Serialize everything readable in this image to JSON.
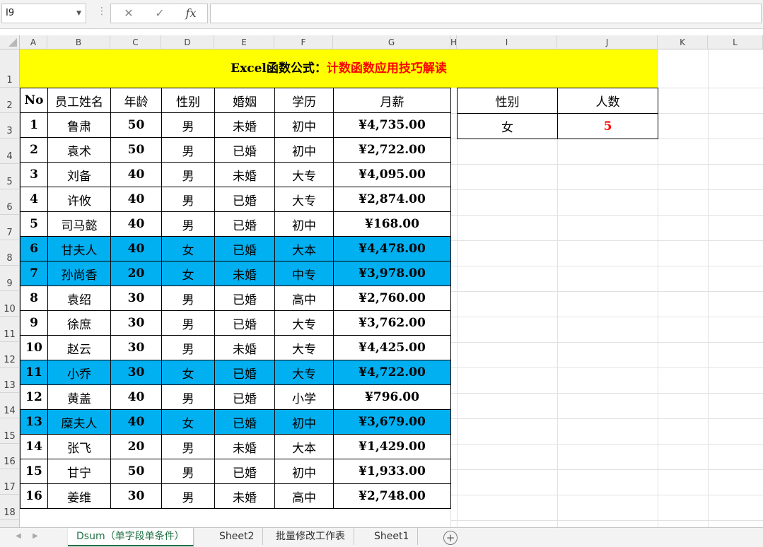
{
  "formula_bar": {
    "name_box": "I9",
    "cancel_icon": "✕",
    "enter_icon": "✓",
    "fx_label": "fx",
    "formula": ""
  },
  "columns": [
    "A",
    "B",
    "C",
    "D",
    "E",
    "F",
    "G",
    "H",
    "I",
    "J",
    "K",
    "L"
  ],
  "rows": [
    "1",
    "2",
    "3",
    "4",
    "5",
    "6",
    "7",
    "8",
    "9",
    "10",
    "11",
    "12",
    "13",
    "14",
    "15",
    "16",
    "17",
    "18"
  ],
  "title": {
    "part1": "Excel函数公式：",
    "part2": "计数函数应用技巧解读"
  },
  "table": {
    "headers": [
      "No",
      "员工姓名",
      "年龄",
      "性别",
      "婚姻",
      "学历",
      "月薪"
    ],
    "rows": [
      [
        "1",
        "鲁肃",
        "50",
        "男",
        "未婚",
        "初中",
        "¥4,735.00"
      ],
      [
        "2",
        "袁术",
        "50",
        "男",
        "已婚",
        "初中",
        "¥2,722.00"
      ],
      [
        "3",
        "刘备",
        "40",
        "男",
        "未婚",
        "大专",
        "¥4,095.00"
      ],
      [
        "4",
        "许攸",
        "40",
        "男",
        "已婚",
        "大专",
        "¥2,874.00"
      ],
      [
        "5",
        "司马懿",
        "40",
        "男",
        "已婚",
        "初中",
        "¥168.00"
      ],
      [
        "6",
        "甘夫人",
        "40",
        "女",
        "已婚",
        "大本",
        "¥4,478.00"
      ],
      [
        "7",
        "孙尚香",
        "20",
        "女",
        "未婚",
        "中专",
        "¥3,978.00"
      ],
      [
        "8",
        "袁绍",
        "30",
        "男",
        "已婚",
        "高中",
        "¥2,760.00"
      ],
      [
        "9",
        "徐庶",
        "30",
        "男",
        "已婚",
        "大专",
        "¥3,762.00"
      ],
      [
        "10",
        "赵云",
        "30",
        "男",
        "未婚",
        "大专",
        "¥4,425.00"
      ],
      [
        "11",
        "小乔",
        "30",
        "女",
        "已婚",
        "大专",
        "¥4,722.00"
      ],
      [
        "12",
        "黄盖",
        "40",
        "男",
        "已婚",
        "小学",
        "¥796.00"
      ],
      [
        "13",
        "糜夫人",
        "40",
        "女",
        "已婚",
        "初中",
        "¥3,679.00"
      ],
      [
        "14",
        "张飞",
        "20",
        "男",
        "未婚",
        "大本",
        "¥1,429.00"
      ],
      [
        "15",
        "甘宁",
        "50",
        "男",
        "已婚",
        "初中",
        "¥1,933.00"
      ],
      [
        "16",
        "姜维",
        "30",
        "男",
        "未婚",
        "高中",
        "¥2,748.00"
      ]
    ],
    "highlighted_rows": [
      "6",
      "7",
      "11",
      "13"
    ],
    "highlight_color": "#00b0f0"
  },
  "summary": {
    "headers": [
      "性别",
      "人数"
    ],
    "gender": "女",
    "count": "5"
  },
  "sheet_tabs": [
    "Dsum（单字段单条件）",
    "Sheet2",
    "批量修改工作表",
    "Sheet1"
  ],
  "active_tab": "Dsum（单字段单条件）",
  "colors": {
    "title_bg": "#ffff00",
    "title_accent": "#ff0000",
    "count_color": "#ff0000",
    "active_tab": "#217346"
  }
}
